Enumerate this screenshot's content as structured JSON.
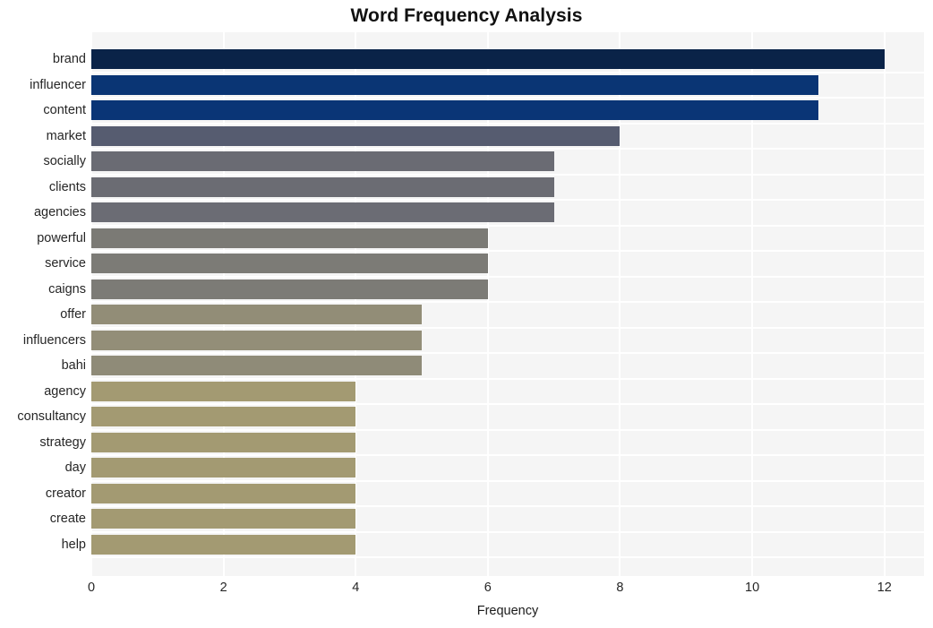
{
  "chart_data": {
    "type": "bar",
    "orientation": "horizontal",
    "title": "Word Frequency Analysis",
    "xlabel": "Frequency",
    "ylabel": "",
    "categories": [
      "brand",
      "influencer",
      "content",
      "market",
      "socially",
      "clients",
      "agencies",
      "powerful",
      "service",
      "caigns",
      "offer",
      "influencers",
      "bahi",
      "agency",
      "consultancy",
      "strategy",
      "day",
      "creator",
      "create",
      "help"
    ],
    "values": [
      12,
      11,
      11,
      8,
      7,
      7,
      7,
      6,
      6,
      6,
      5,
      5,
      5,
      4,
      4,
      4,
      4,
      4,
      4,
      4
    ],
    "bar_colors": [
      "#0a2348",
      "#0a3574",
      "#0a3576",
      "#565c70",
      "#6a6b73",
      "#6b6c73",
      "#6b6c74",
      "#7b7a75",
      "#7c7b76",
      "#7c7b76",
      "#928d77",
      "#938e78",
      "#8f8b78",
      "#a39a72",
      "#a39a72",
      "#a39a72",
      "#a39a72",
      "#a39a72",
      "#a39a72",
      "#a39a72"
    ],
    "xticks": [
      "0",
      "2",
      "4",
      "6",
      "8",
      "10",
      "12"
    ],
    "xtick_values": [
      0,
      2,
      4,
      6,
      8,
      10,
      12
    ],
    "xlim": [
      0,
      12.6
    ],
    "grid": true,
    "grid_color": "#ffffff",
    "plot_background": "#f5f5f5",
    "figure_background": "#ffffff",
    "legend": null
  }
}
